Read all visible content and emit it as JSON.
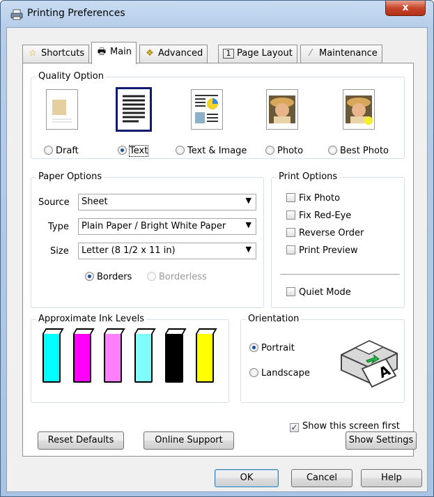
{
  "window": {
    "title": "Printing Preferences",
    "close_glyph": "x"
  },
  "tabs": [
    {
      "label": "Shortcuts",
      "icon": "star-icon"
    },
    {
      "label": "Main",
      "icon": "printer-icon"
    },
    {
      "label": "Advanced",
      "icon": "advanced-icon"
    },
    {
      "label": "Page Layout",
      "icon": "page-layout-icon"
    },
    {
      "label": "Maintenance",
      "icon": "wrench-icon"
    }
  ],
  "quality": {
    "title": "Quality Option",
    "options": [
      {
        "label": "Draft",
        "selected": false
      },
      {
        "label": "Text",
        "selected": true
      },
      {
        "label": "Text & Image",
        "selected": false
      },
      {
        "label": "Photo",
        "selected": false
      },
      {
        "label": "Best Photo",
        "selected": false
      }
    ]
  },
  "paper": {
    "title": "Paper Options",
    "source_label": "Source",
    "source_value": "Sheet",
    "type_label": "Type",
    "type_value": "Plain Paper / Bright White Paper",
    "size_label": "Size",
    "size_value": "Letter (8 1/2 x 11 in)",
    "borders_label": "Borders",
    "borderless_label": "Borderless"
  },
  "print_options": {
    "title": "Print Options",
    "fix_photo": "Fix Photo",
    "fix_red_eye": "Fix Red-Eye",
    "reverse_order": "Reverse Order",
    "print_preview": "Print Preview",
    "quiet_mode": "Quiet Mode"
  },
  "ink": {
    "title": "Approximate Ink Levels",
    "colors": [
      "#00ffff",
      "#ff00ff",
      "#ff80ff",
      "#80ffff",
      "#000000",
      "#ffff00"
    ]
  },
  "orientation": {
    "title": "Orientation",
    "portrait": "Portrait",
    "landscape": "Landscape",
    "selected": "Portrait"
  },
  "show_first": {
    "label": "Show this screen first",
    "checked": true
  },
  "buttons": {
    "reset": "Reset Defaults",
    "online": "Online Support",
    "show_settings": "Show Settings",
    "ok": "OK",
    "cancel": "Cancel",
    "help": "Help"
  }
}
